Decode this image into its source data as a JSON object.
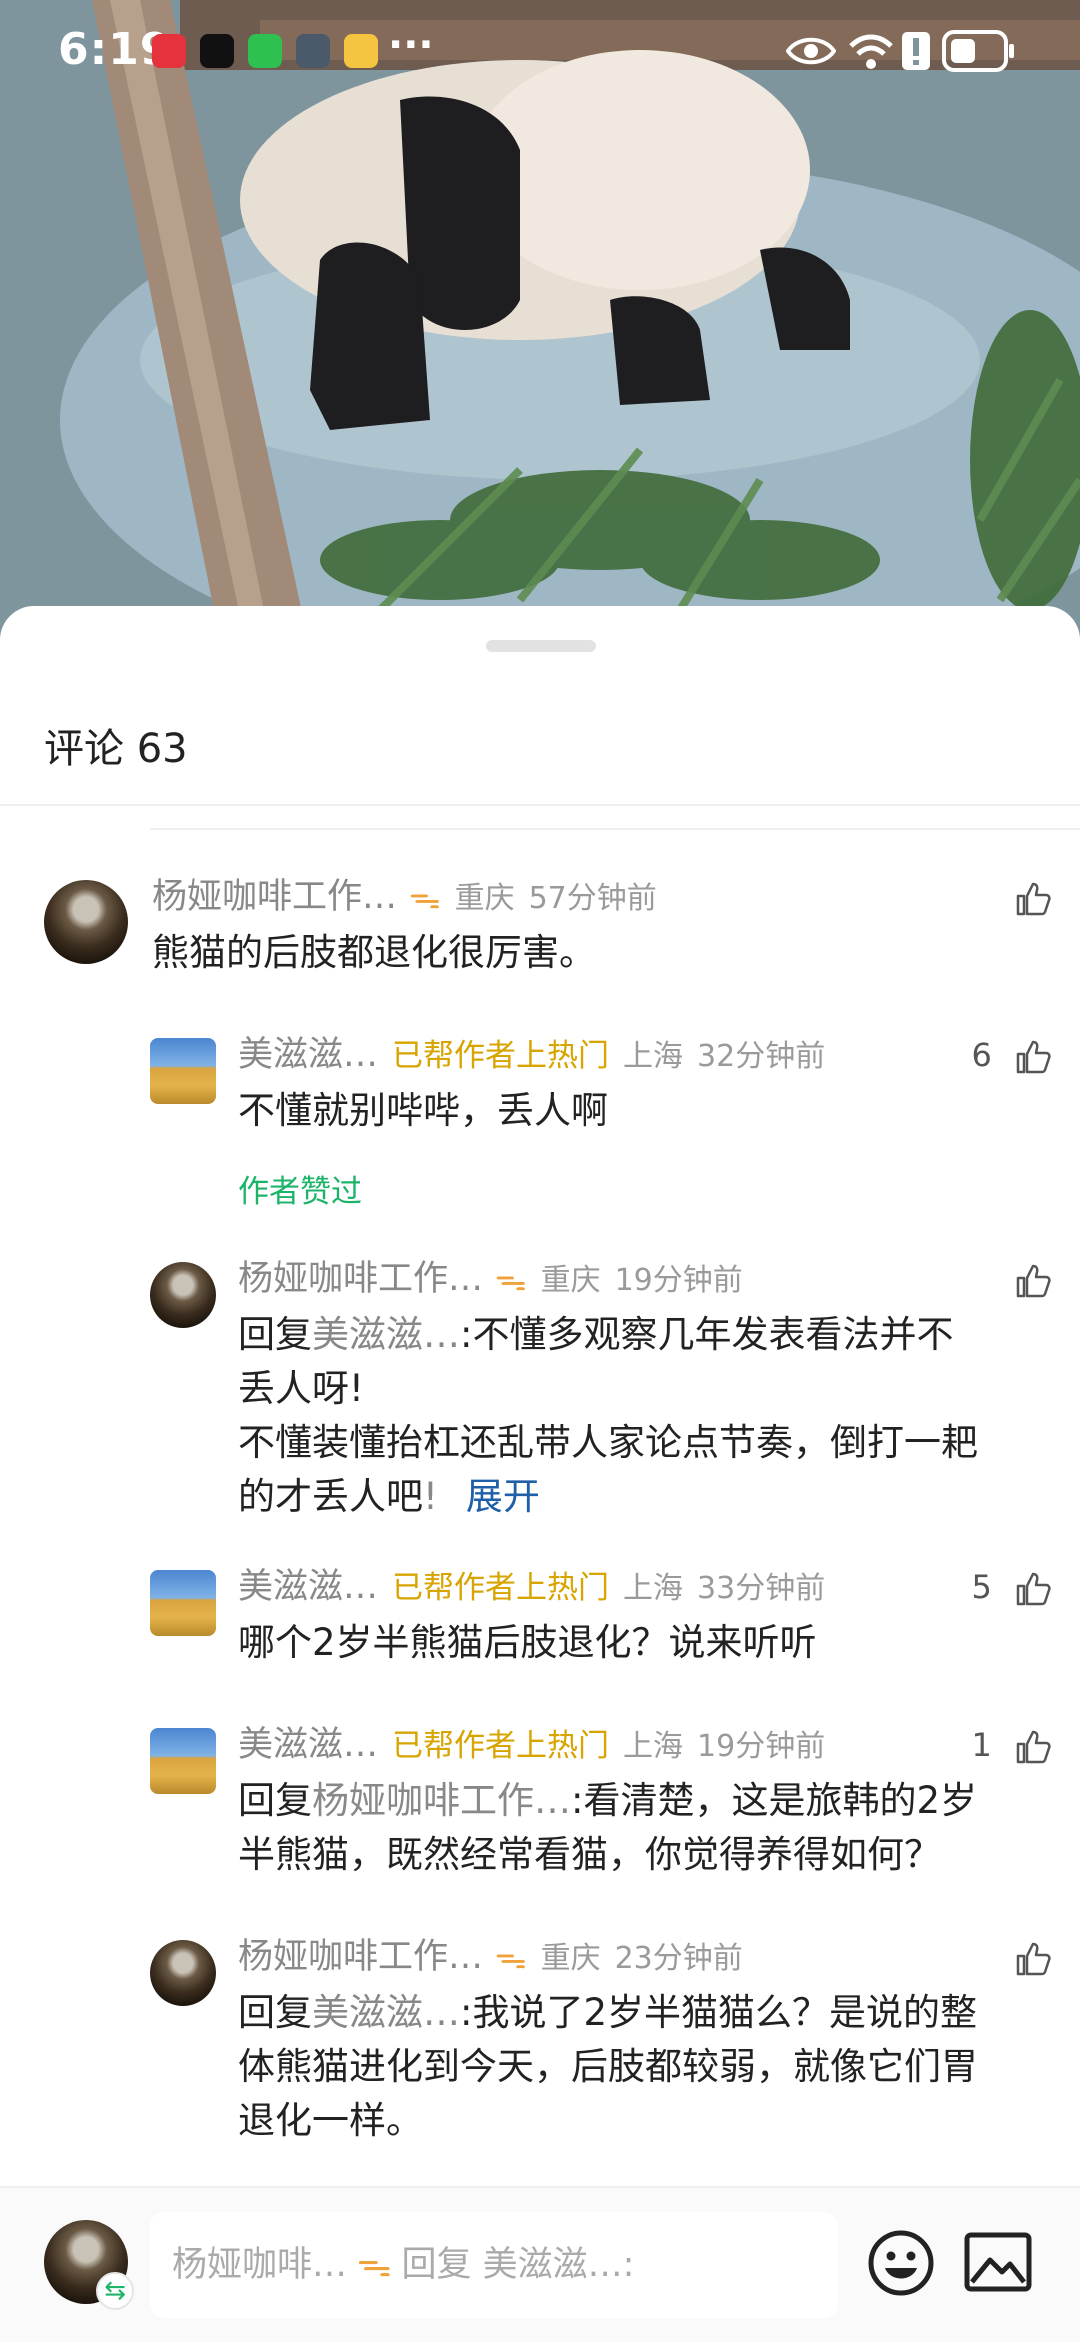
{
  "status_bar": {
    "time": "6:19",
    "more": "···"
  },
  "header": {
    "title": "评论 63"
  },
  "comments": [
    {
      "user": "杨娅咖啡工作…",
      "vip": "ᯓ",
      "location": "重庆",
      "time": "57分钟前",
      "likes": "",
      "text": "熊猫的后肢都退化很厉害。"
    },
    {
      "user": "美滋滋…",
      "badge": "已帮作者上热门",
      "location": "上海",
      "time": "32分钟前",
      "likes": "6",
      "text": "不懂就别哔哔，丢人啊",
      "author_liked": "作者赞过"
    },
    {
      "user": "杨娅咖啡工作…",
      "vip": "ᯓ",
      "location": "重庆",
      "time": "19分钟前",
      "likes": "",
      "reply_prefix": "回复",
      "reply_to": "美滋滋…",
      "text_line1": ":不懂多观察几年发表看法并不",
      "text_line2": "丢人呀!",
      "text_line3": "不懂装懂抬杠还乱带人家论点节奏，倒打一耙",
      "text_line4": "的才丢人吧",
      "text_fade": "!",
      "expand": "展开"
    },
    {
      "user": "美滋滋…",
      "badge": "已帮作者上热门",
      "location": "上海",
      "time": "33分钟前",
      "likes": "5",
      "text": "哪个2岁半熊猫后肢退化？说来听听"
    },
    {
      "user": "美滋滋…",
      "badge": "已帮作者上热门",
      "location": "上海",
      "time": "19分钟前",
      "likes": "1",
      "reply_prefix": "回复",
      "reply_to": "杨娅咖啡工作…",
      "text_line1": ":看清楚，这是旅韩的2岁",
      "text_line2": "半熊猫，既然经常看猫，你觉得养得如何？"
    },
    {
      "user": "杨娅咖啡工作…",
      "vip": "ᯓ",
      "location": "重庆",
      "time": "23分钟前",
      "likes": "",
      "reply_prefix": "回复",
      "reply_to": "美滋滋…",
      "text_line1": ":我说了2岁半猫猫么？是说的整",
      "text_line2": "体熊猫进化到今天，后肢都较弱，就像它们胃",
      "text_line3": "退化一样。"
    }
  ],
  "input_bar": {
    "placeholder_user": "杨娅咖啡…",
    "vip": "ᯓ",
    "placeholder_reply": "回复 美滋滋…:",
    "swap_symbol": "⇆"
  }
}
